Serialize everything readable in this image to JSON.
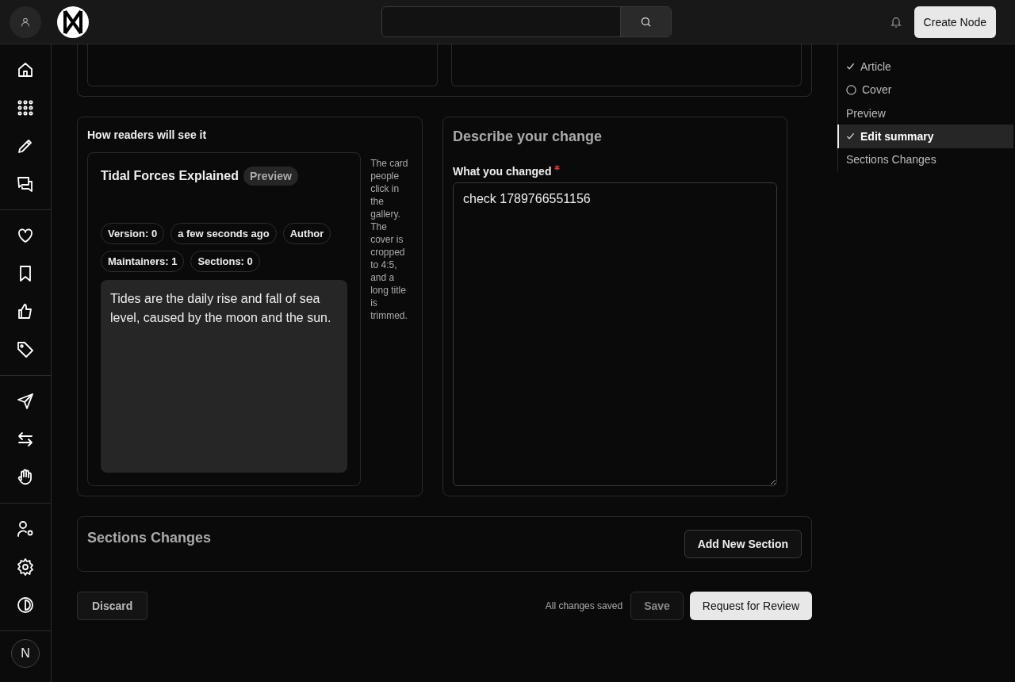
{
  "header": {
    "create_button": "Create Node"
  },
  "sidebar": {
    "avatar": "N"
  },
  "preview_panel": {
    "heading": "How readers will see it",
    "card": {
      "title": "Tidal Forces Explained",
      "badge": "Preview",
      "chips": [
        "Version: 0",
        "a few seconds ago",
        "Author",
        "Maintainers: 1",
        "Sections: 0"
      ],
      "summary": "Tides are the daily rise and fall of sea level, caused by the moon and the sun."
    },
    "note": "The card people click in the gallery. The cover is cropped to 4:5, and a long title is trimmed."
  },
  "change_panel": {
    "heading": "Describe your change",
    "label": "What you changed",
    "required": true,
    "value": "check 1789766551156"
  },
  "sections_panel": {
    "heading": "Sections Changes",
    "button": "Add New Section"
  },
  "footer": {
    "discard": "Discard",
    "status": "All changes saved",
    "save": {
      "label": "Save",
      "disabled": true
    },
    "submit": "Request for Review"
  },
  "outline": [
    {
      "label": "Article",
      "kind": "done",
      "selected": false
    },
    {
      "label": "Cover",
      "kind": "pending",
      "selected": false
    },
    {
      "label": "Preview",
      "kind": "plain",
      "selected": false
    },
    {
      "label": "Edit summary",
      "kind": "done",
      "selected": true
    },
    {
      "label": "Sections Changes",
      "kind": "plain",
      "selected": false
    }
  ]
}
